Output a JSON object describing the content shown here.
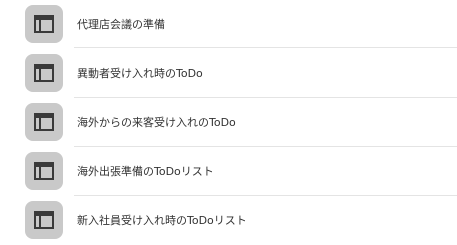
{
  "list": {
    "items": [
      {
        "label": "代理店会議の準備",
        "icon": "template-icon"
      },
      {
        "label": "異動者受け入れ時のToDo",
        "icon": "template-icon"
      },
      {
        "label": "海外からの来客受け入れのToDo",
        "icon": "template-icon"
      },
      {
        "label": "海外出張準備のToDoリスト",
        "icon": "template-icon"
      },
      {
        "label": "新入社員受け入れ時のToDoリスト",
        "icon": "template-icon"
      }
    ]
  },
  "colors": {
    "icon_tile": "#c9c9c9",
    "icon_glyph": "#3a3a3a",
    "text": "#333333",
    "divider": "#e4e4e4"
  }
}
